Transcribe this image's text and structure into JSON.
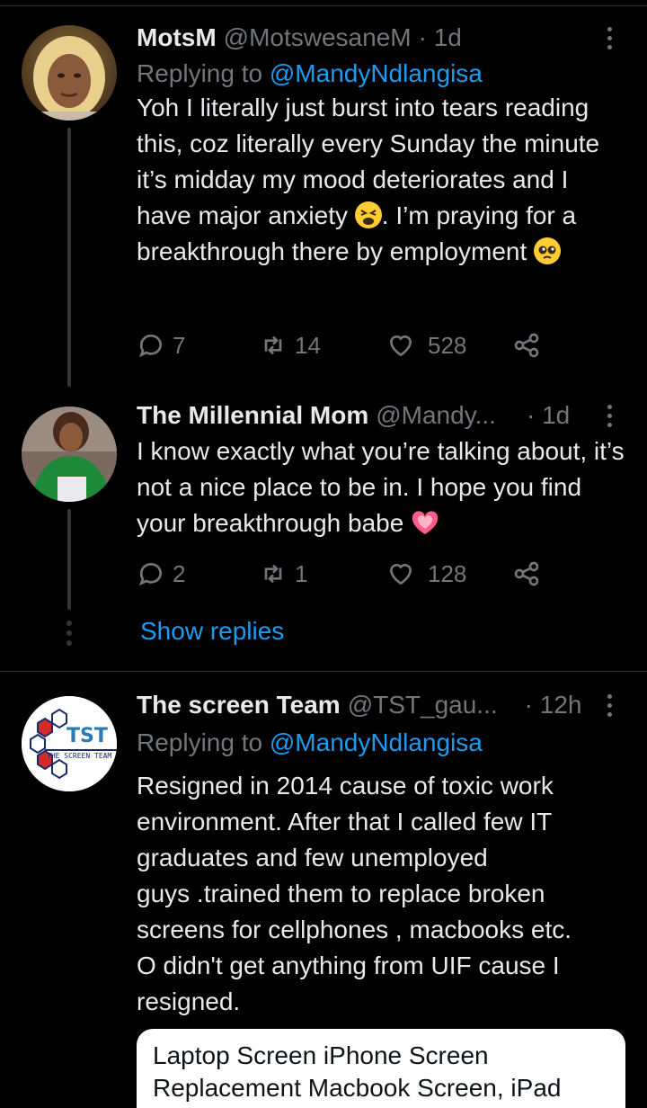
{
  "tweets": [
    {
      "name": "MotsM",
      "handle": "@MotswesaneM",
      "time": "· 1d",
      "replying_prefix": "Replying to ",
      "replying_to": "@MandyNdlangisa",
      "text_part1": "Yoh I literally just burst into tears reading this, coz literally every Sunday the minute it’s midday my mood deteriorates and I have major anxiety ",
      "text_part2": ". I’m praying for a breakthrough there by employment ",
      "emoji1": "tired-face-emoji",
      "emoji2": "pleading-face-emoji",
      "replies": "7",
      "retweets": "14",
      "likes": "528"
    },
    {
      "name": "The Millennial Mom",
      "handle": "@Mandy...",
      "time": "· 1d",
      "text_part1": "I know exactly what you’re talking about, it’s not a nice place to be in. I hope you find your breakthrough babe ",
      "emoji1": "sparkling-heart-emoji",
      "replies": "2",
      "retweets": "1",
      "likes": "128",
      "show_replies": "Show replies"
    },
    {
      "name": "The screen Team",
      "handle": "@TST_gau...",
      "time": "· 12h",
      "replying_prefix": "Replying to ",
      "replying_to": "@MandyNdlangisa",
      "avatar_logo_text": "TST",
      "avatar_logo_subtext": "THE SCREEN TEAM",
      "text_line1": "Resigned in 2014 cause of toxic work",
      "text_line2": "environment. After that I called few IT",
      "text_line3": "graduates and few unemployed",
      "text_line4": "guys .trained them to replace broken",
      "text_line5": "screens for cellphones , macbooks etc.",
      "text_line6": "O didn't get anything from UIF cause I",
      "text_line7": "resigned.",
      "card_line1": "Laptop Screen iPhone Screen",
      "card_line2": "Replacement Macbook Screen, iPad"
    }
  ],
  "colors": {
    "background": "#000000",
    "text": "#e7e9ea",
    "muted": "#71767b",
    "link": "#1d9bf0",
    "divider": "#2f3336"
  }
}
